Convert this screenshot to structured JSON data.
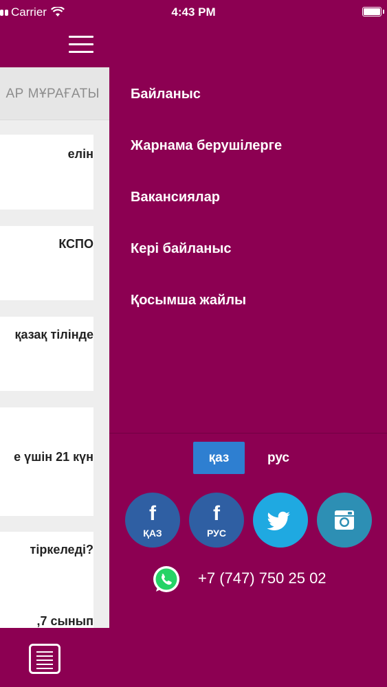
{
  "status_bar": {
    "carrier": "Carrier",
    "time": "4:43 PM"
  },
  "content_panel": {
    "header": "АР МҰРАҒАТЫ",
    "cards": [
      {
        "text": "елін"
      },
      {
        "text": "КСПО"
      },
      {
        "text": "қазақ тілінде"
      },
      {
        "text": "е үшін 21 күн"
      },
      {
        "text": "тіркеледі?"
      },
      {
        "text": ",7 сынып"
      }
    ]
  },
  "menu": {
    "items": [
      {
        "label": "Байланыс"
      },
      {
        "label": "Жарнама берушілерге"
      },
      {
        "label": "Вакансиялар"
      },
      {
        "label": "Кері байланыс"
      },
      {
        "label": "Қосымша жайлы"
      }
    ]
  },
  "language": {
    "active": "қаз",
    "inactive": "рус"
  },
  "socials": {
    "fb_kaz_label": "ҚАЗ",
    "fb_rus_label": "РУС",
    "icons": [
      "facebook-icon",
      "facebook-icon",
      "twitter-icon",
      "instagram-icon"
    ]
  },
  "contact": {
    "phone": "+7 (747) 750 25 02"
  },
  "colors": {
    "background": "#8c0052",
    "active_lang": "#2e7fd1",
    "facebook": "#2f5fa3",
    "twitter": "#1fa9e1",
    "instagram": "#2d8fb4",
    "whatsapp": "#25d366"
  }
}
